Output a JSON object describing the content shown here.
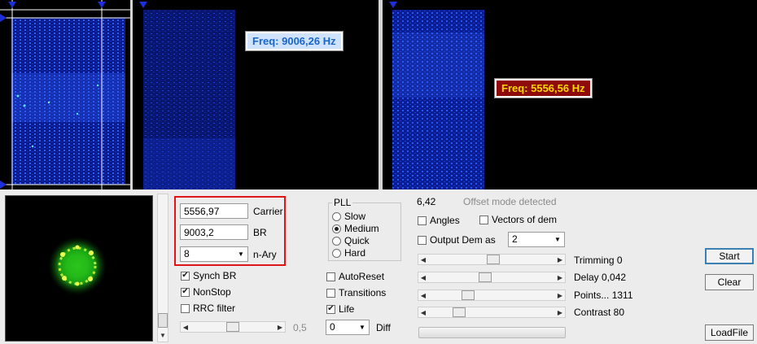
{
  "spectrograms": {
    "freq_label_1": "Freq: 9006,26 Hz",
    "freq_label_2": "Freq: 5556,56 Hz",
    "freq_label_1_color": "#1a66c8",
    "freq_label_2_color": "#8f0b0b"
  },
  "controls": {
    "carrier_value": "5556,97",
    "carrier_label": "Carrier",
    "br_value": "9003,2",
    "br_label": "BR",
    "nary_value": "8",
    "nary_label": "n-Ary",
    "synch_br": "Synch BR",
    "nonstop": "NonStop",
    "rrc_filter": "RRC filter",
    "bottom_slider_value": "0,5",
    "auto_reset": "AutoReset",
    "transitions": "Transitions",
    "life": "Life",
    "diff_value": "0",
    "diff_label": "Diff"
  },
  "pll": {
    "title": "PLL",
    "options": [
      "Slow",
      "Medium",
      "Quick",
      "Hard"
    ],
    "selected": "Medium"
  },
  "right": {
    "value": "6,42",
    "offset_mode": "Offset mode detected",
    "angles": "Angles",
    "vectors_of_dem": "Vectors of dem",
    "output_dem_as": "Output Dem as",
    "output_dem_value": "2",
    "trimming": "Trimming 0",
    "delay": "Delay  0,042",
    "points": "Points... 1311",
    "contrast": "Contrast 80",
    "start": "Start",
    "clear": "Clear",
    "loadfile": "LoadFile"
  },
  "icons": {
    "marker": "blue-triangle-marker",
    "dropdown": "chevron-down-icon",
    "check": "checkmark-icon",
    "slider_left": "arrow-left-icon",
    "slider_right": "arrow-right-icon"
  },
  "colors": {
    "highlight_border": "#e0141a",
    "marker_blue": "#1c2fd8",
    "constellation_green": "#3aff22"
  }
}
